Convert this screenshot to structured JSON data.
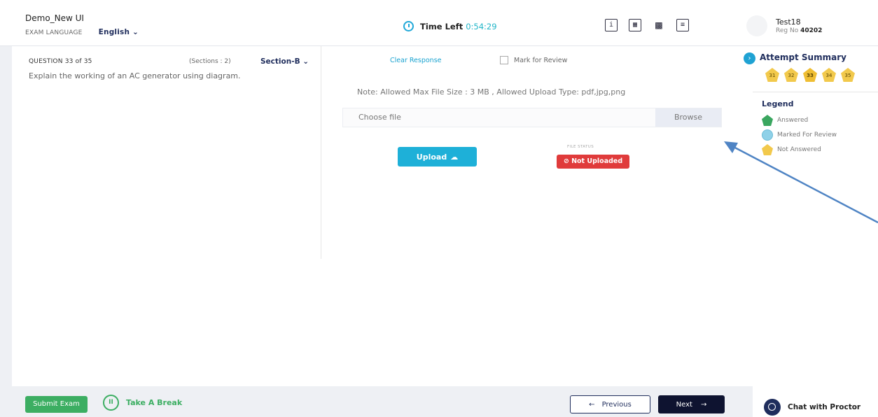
{
  "header": {
    "exam_name": "Demo_New UI",
    "language_label": "EXAM LANGUAGE",
    "language_value": "English ⌄",
    "timer_label": "Time Left",
    "timer_value": "0:54:29",
    "tools": [
      {
        "name": "info-icon",
        "glyph": "i"
      },
      {
        "name": "calculator-icon",
        "glyph": "▦"
      },
      {
        "name": "qr-code-icon",
        "glyph": "▩"
      },
      {
        "name": "document-icon",
        "glyph": "≡"
      }
    ],
    "user_name": "Test18",
    "reg_label": "Reg No",
    "reg_no": "40202"
  },
  "question": {
    "number_label": "QUESTION 33 of 35",
    "sections_label": "(Sections : 2)",
    "section_select": "Section-B ⌄",
    "text": "Explain the working of an AC generator using diagram."
  },
  "response": {
    "clear_label": "Clear Response",
    "mark_review_label": "Mark for Review",
    "note": "Note: Allowed Max File Size : 3 MB , Allowed Upload Type: pdf,jpg,png",
    "file_placeholder": "Choose file",
    "browse_label": "Browse",
    "upload_label": "Upload",
    "upload_icon": "☁",
    "file_status_label": "FILE STATUS",
    "status_text": "⊘ Not Uploaded"
  },
  "footer": {
    "submit_label": "Submit Exam",
    "break_icon": "II",
    "break_label": "Take A Break",
    "prev_label": "Previous",
    "prev_icon": "←",
    "next_label": "Next",
    "next_icon": "→"
  },
  "summary": {
    "toggle_icon": "›",
    "title": "Attempt Summary",
    "questions": [
      "31",
      "32",
      "33",
      "34",
      "35"
    ],
    "current_question": "33",
    "legend_title": "Legend",
    "legend": [
      {
        "label": "Answered",
        "color": "#3aa65f"
      },
      {
        "label": "Marked For Review",
        "color": "#8fd1e8"
      },
      {
        "label": "Not Answered",
        "color": "#f2c94c"
      }
    ],
    "chat_label": "Chat with Proctor"
  },
  "colors": {
    "accent": "#1eb0d8",
    "navy": "#1f2d5c",
    "success": "#3cae62",
    "danger": "#e03b3b",
    "annotation_arrow": "#4f84c4"
  }
}
